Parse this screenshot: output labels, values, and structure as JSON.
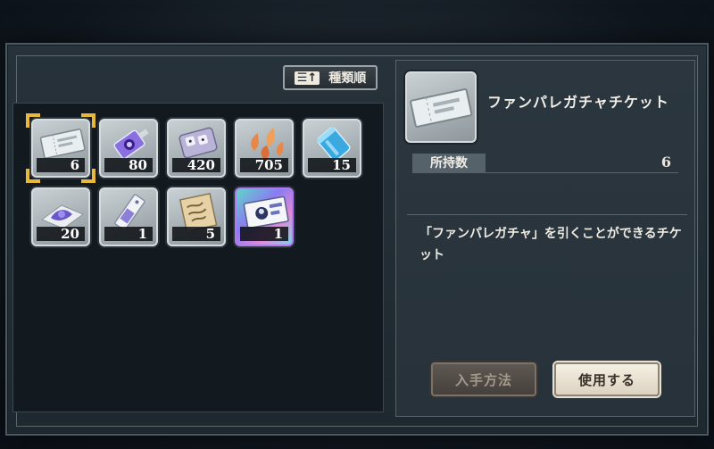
{
  "sort_button": {
    "icon": "sort-icon",
    "label": "種類順"
  },
  "items": [
    {
      "icon": "ticket-icon",
      "count": "6",
      "selected": true
    },
    {
      "icon": "purple-key-icon",
      "count": "80"
    },
    {
      "icon": "dice-box-icon",
      "count": "420"
    },
    {
      "icon": "flame-petal-icon",
      "count": "705"
    },
    {
      "icon": "blue-canister-icon",
      "count": "15"
    },
    {
      "icon": "purple-powder-icon",
      "count": "20"
    },
    {
      "icon": "bookmark-icon",
      "count": "1"
    },
    {
      "icon": "parchment-icon",
      "count": "5"
    },
    {
      "icon": "rainbow-ticket-icon",
      "count": "1"
    }
  ],
  "detail": {
    "name": "ファンパレガチャチケット",
    "owned_label": "所持数",
    "owned_value": "6",
    "description": "「ファンパレガチャ」を引くことができるチケット",
    "howto_button": "入手方法",
    "use_button": "使用する"
  },
  "colors": {
    "selection": "#e8b83a",
    "panel": "#121a20",
    "accent_rainbow": "#b07af0"
  }
}
